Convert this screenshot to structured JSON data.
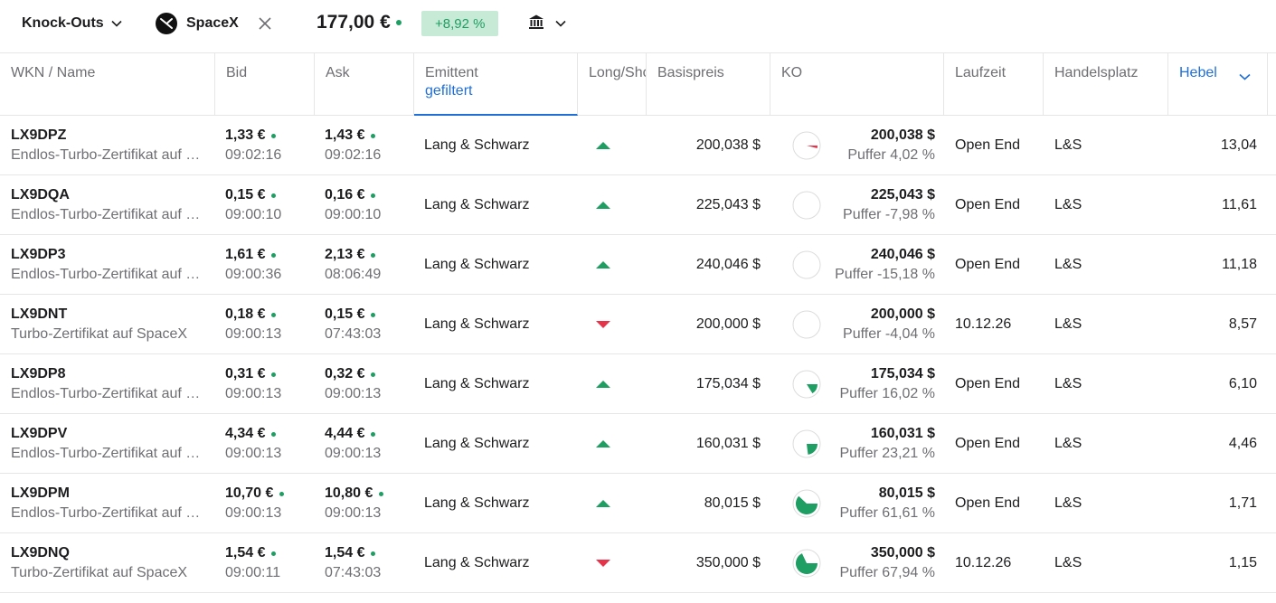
{
  "header": {
    "product_type": "Knock-Outs",
    "underlying": "SpaceX",
    "price": "177,00 €",
    "change": "+8,92 %",
    "icons": {
      "product_chevron": "chevron-down-icon",
      "logo": "spacex-logo-icon",
      "close": "close-icon",
      "venue": "bank-icon",
      "venue_chevron": "chevron-down-icon"
    },
    "colors": {
      "positive": "#1e9e63",
      "positive_bg": "#c7ead6",
      "negative": "#e5334a",
      "accent": "#1f6fd6"
    }
  },
  "columns": {
    "wkn": "WKN / Name",
    "bid": "Bid",
    "ask": "Ask",
    "issuer": "Emittent",
    "issuer_filter": "gefiltert",
    "direction": "Long/Short",
    "strike": "Basispreis",
    "ko": "KO",
    "term": "Laufzeit",
    "venue": "Handelsplatz",
    "leverage": "Hebel"
  },
  "rows": [
    {
      "wkn": "LX9DPZ",
      "name": "Endlos-Turbo-Zertifikat auf SpaceX",
      "bid": "1,33 €",
      "bid_time": "09:02:16",
      "ask": "1,43 €",
      "ask_time": "09:02:16",
      "issuer": "Lang & Schwarz",
      "direction": "long",
      "strike": "200,038 $",
      "ko": "200,038 $",
      "buffer": "Puffer 4,02 %",
      "buffer_fraction": 0.04,
      "term": "Open End",
      "venue": "L&S",
      "leverage": "13,04"
    },
    {
      "wkn": "LX9DQA",
      "name": "Endlos-Turbo-Zertifikat auf SpaceX",
      "bid": "0,15 €",
      "bid_time": "09:00:10",
      "ask": "0,16 €",
      "ask_time": "09:00:10",
      "issuer": "Lang & Schwarz",
      "direction": "long",
      "strike": "225,043 $",
      "ko": "225,043 $",
      "buffer": "Puffer -7,98 %",
      "buffer_fraction": 0,
      "term": "Open End",
      "venue": "L&S",
      "leverage": "11,61"
    },
    {
      "wkn": "LX9DP3",
      "name": "Endlos-Turbo-Zertifikat auf SpaceX",
      "bid": "1,61 €",
      "bid_time": "09:00:36",
      "ask": "2,13 €",
      "ask_time": "08:06:49",
      "issuer": "Lang & Schwarz",
      "direction": "long",
      "strike": "240,046 $",
      "ko": "240,046 $",
      "buffer": "Puffer -15,18 %",
      "buffer_fraction": 0,
      "term": "Open End",
      "venue": "L&S",
      "leverage": "11,18"
    },
    {
      "wkn": "LX9DNT",
      "name": "Turbo-Zertifikat auf SpaceX",
      "bid": "0,18 €",
      "bid_time": "09:00:13",
      "ask": "0,15 €",
      "ask_time": "07:43:03",
      "issuer": "Lang & Schwarz",
      "direction": "short",
      "strike": "200,000 $",
      "ko": "200,000 $",
      "buffer": "Puffer -4,04 %",
      "buffer_fraction": 0,
      "term": "10.12.26",
      "venue": "L&S",
      "leverage": "8,57"
    },
    {
      "wkn": "LX9DP8",
      "name": "Endlos-Turbo-Zertifikat auf SpaceX",
      "bid": "0,31 €",
      "bid_time": "09:00:13",
      "ask": "0,32 €",
      "ask_time": "09:00:13",
      "issuer": "Lang & Schwarz",
      "direction": "long",
      "strike": "175,034 $",
      "ko": "175,034 $",
      "buffer": "Puffer 16,02 %",
      "buffer_fraction": 0.16,
      "term": "Open End",
      "venue": "L&S",
      "leverage": "6,10"
    },
    {
      "wkn": "LX9DPV",
      "name": "Endlos-Turbo-Zertifikat auf SpaceX",
      "bid": "4,34 €",
      "bid_time": "09:00:13",
      "ask": "4,44 €",
      "ask_time": "09:00:13",
      "issuer": "Lang & Schwarz",
      "direction": "long",
      "strike": "160,031 $",
      "ko": "160,031 $",
      "buffer": "Puffer 23,21 %",
      "buffer_fraction": 0.23,
      "term": "Open End",
      "venue": "L&S",
      "leverage": "4,46"
    },
    {
      "wkn": "LX9DPM",
      "name": "Endlos-Turbo-Zertifikat auf SpaceX",
      "bid": "10,70 €",
      "bid_time": "09:00:13",
      "ask": "10,80 €",
      "ask_time": "09:00:13",
      "issuer": "Lang & Schwarz",
      "direction": "long",
      "strike": "80,015 $",
      "ko": "80,015 $",
      "buffer": "Puffer 61,61 %",
      "buffer_fraction": 0.62,
      "term": "Open End",
      "venue": "L&S",
      "leverage": "1,71"
    },
    {
      "wkn": "LX9DNQ",
      "name": "Turbo-Zertifikat auf SpaceX",
      "bid": "1,54 €",
      "bid_time": "09:00:11",
      "ask": "1,54 €",
      "ask_time": "07:43:03",
      "issuer": "Lang & Schwarz",
      "direction": "short",
      "strike": "350,000 $",
      "ko": "350,000 $",
      "buffer": "Puffer 67,94 %",
      "buffer_fraction": 0.68,
      "term": "10.12.26",
      "venue": "L&S",
      "leverage": "1,15"
    }
  ]
}
